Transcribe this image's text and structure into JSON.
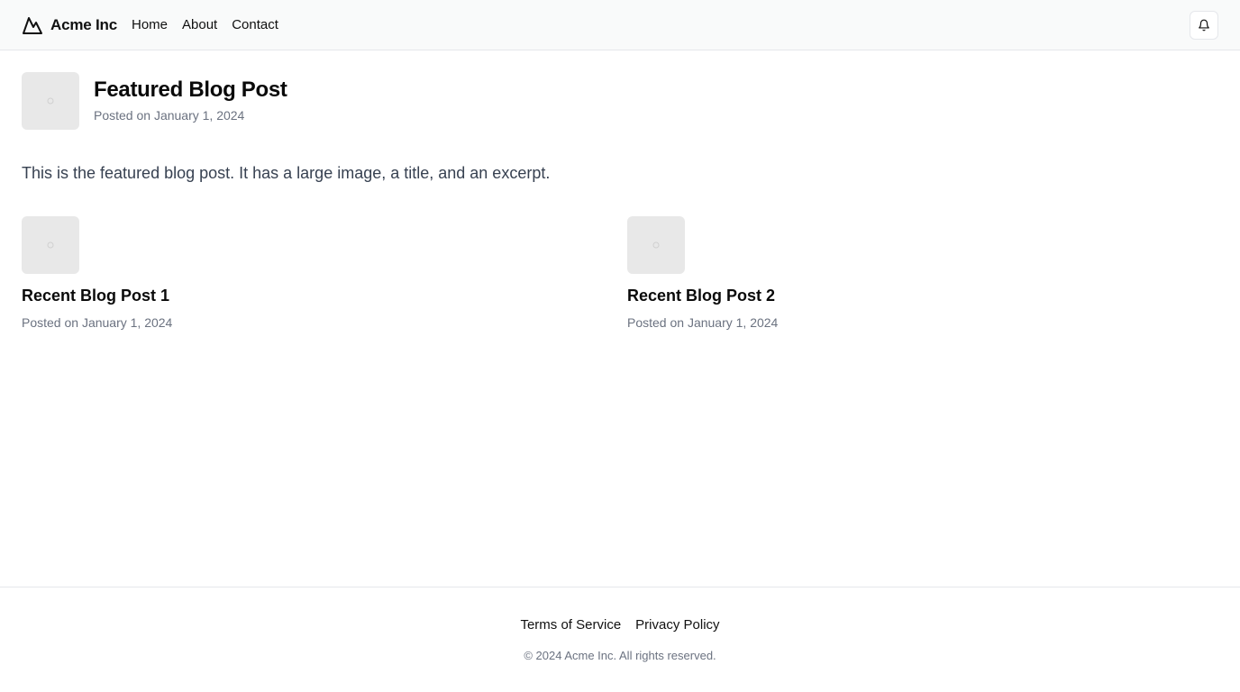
{
  "header": {
    "brand_name": "Acme Inc",
    "brand_icon": "mountain-icon",
    "nav": [
      "Home",
      "About",
      "Contact"
    ],
    "notification_icon": "bell-icon"
  },
  "featured": {
    "image_icon": "image-placeholder-icon",
    "title": "Featured Blog Post",
    "meta": "Posted on January 1, 2024",
    "excerpt": "This is the featured blog post. It has a large image, a title, and an excerpt."
  },
  "recent": [
    {
      "title": "Recent Blog Post 1",
      "meta": "Posted on January 1, 2024"
    },
    {
      "title": "Recent Blog Post 2",
      "meta": "Posted on January 1, 2024"
    }
  ],
  "footer": {
    "links": [
      "Terms of Service",
      "Privacy Policy"
    ],
    "copyright": "© 2024 Acme Inc. All rights reserved."
  },
  "colors": {
    "header_bg": "#f9fafa",
    "border": "#e5e7eb",
    "muted_text": "#6b7280",
    "placeholder_bg": "#e8e8e8"
  }
}
